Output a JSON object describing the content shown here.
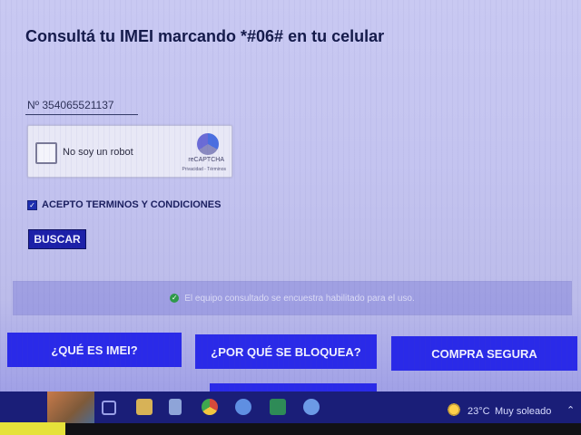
{
  "page": {
    "title": "Consultá tu IMEI marcando *#06# en tu celular",
    "imei_value": "Nº 354065521137"
  },
  "captcha": {
    "label": "No soy un robot",
    "brand": "reCAPTCHA",
    "links": "Privacidad - Términos"
  },
  "terms": {
    "checked": true,
    "label": "ACEPTO TERMINOS Y CONDICIONES"
  },
  "actions": {
    "search_label": "BUSCAR"
  },
  "status": {
    "message": "El equipo consultado se encuestra habilitado para el uso.",
    "color": "#2e9a4a"
  },
  "nav": {
    "what_is_imei": "¿QUÉ ES IMEI?",
    "why_blocked": "¿POR QUÉ SE BLOQUEA?",
    "safe_purchase": "COMPRA SEGURA"
  },
  "taskbar": {
    "icons": [
      "task-view-icon",
      "file-explorer-icon",
      "file-icon",
      "chrome-icon",
      "edge-icon",
      "excel-icon",
      "app-icon"
    ],
    "weather_temp": "23°C",
    "weather_desc": "Muy soleado"
  },
  "colors": {
    "accent": "#2a2ae8",
    "search_button": "#1c20a8",
    "taskbar": "#1a1e78"
  }
}
